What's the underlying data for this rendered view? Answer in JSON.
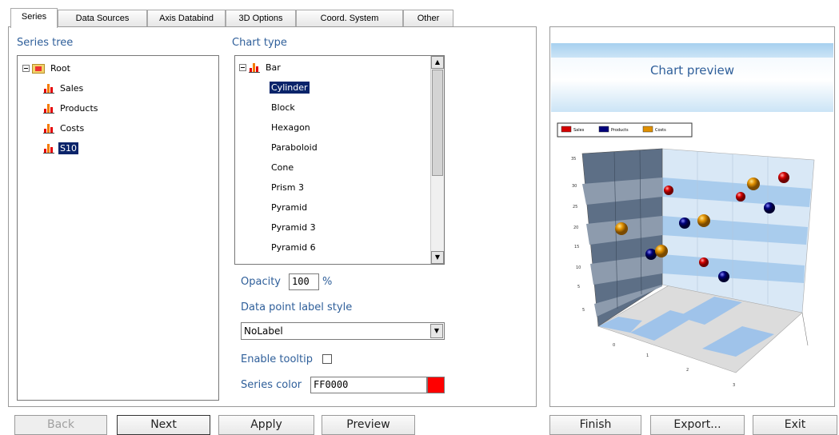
{
  "tabs": [
    {
      "label": "Series"
    },
    {
      "label": "Data Sources"
    },
    {
      "label": "Axis Databind"
    },
    {
      "label": "3D Options"
    },
    {
      "label": "Coord. System"
    },
    {
      "label": "Other"
    }
  ],
  "series_tree": {
    "heading": "Series tree",
    "root": "Root",
    "items": [
      "Sales",
      "Products",
      "Costs",
      "S10"
    ],
    "selected": "S10"
  },
  "chart_type": {
    "heading": "Chart type",
    "group": "Bar",
    "items": [
      "Cylinder",
      "Block",
      "Hexagon",
      "Paraboloid",
      "Cone",
      "Prism 3",
      "Pyramid",
      "Pyramid 3",
      "Pyramid 6"
    ],
    "selected": "Cylinder"
  },
  "opacity": {
    "label": "Opacity",
    "value": "100",
    "unit": "%"
  },
  "label_style": {
    "label": "Data point label style",
    "value": "NoLabel"
  },
  "tooltip": {
    "label": "Enable tooltip",
    "checked": false
  },
  "series_color": {
    "label": "Series color",
    "value": "FF0000",
    "swatch": "#ff0000"
  },
  "preview": {
    "title": "Chart preview",
    "legend": [
      {
        "name": "Sales",
        "color": "#d40000"
      },
      {
        "name": "Products",
        "color": "#00007a"
      },
      {
        "name": "Costs",
        "color": "#e09000"
      }
    ],
    "y_ticks": [
      "5",
      "5",
      "10",
      "15",
      "20",
      "25",
      "30",
      "35"
    ],
    "x_ticks": [
      "0",
      "1",
      "2",
      "3"
    ]
  },
  "buttons": {
    "back": "Back",
    "next": "Next",
    "apply": "Apply",
    "preview": "Preview",
    "finish": "Finish",
    "export": "Export...",
    "exit": "Exit"
  },
  "icons": {
    "scroll_up": "scroll-up-arrow-icon",
    "scroll_down": "scroll-down-arrow-icon",
    "dropdown": "chevron-down-icon"
  }
}
